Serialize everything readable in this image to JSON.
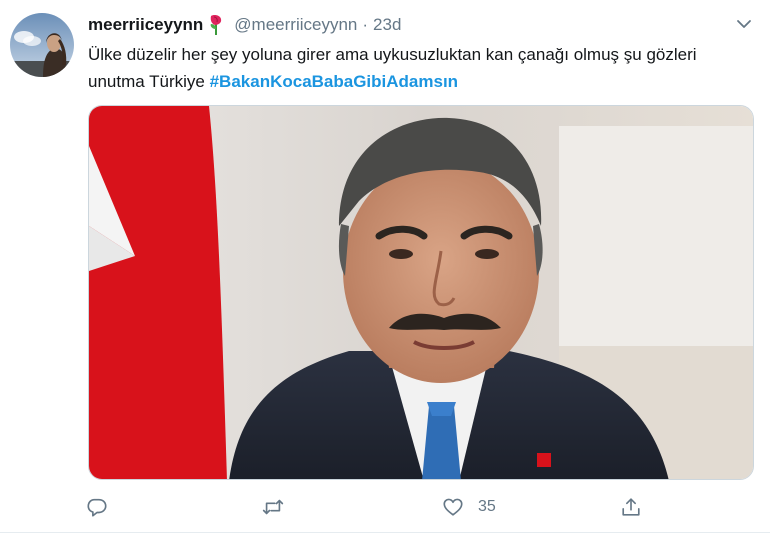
{
  "tweet": {
    "author": {
      "display_name": "meerriiceyynn",
      "name_emoji": "rose-emoji",
      "handle": "@meerriiceyynn",
      "separator": "·",
      "time": "23d"
    },
    "text_plain": "Ülke düzelir her şey yoluna girer ama uykusuzluktan kan çanağı olmuş şu gözleri unutma Türkiye",
    "hashtag": "#BakanKocaBabaGibiAdamsın",
    "media": {
      "type": "photo"
    },
    "actions": {
      "reply": {
        "icon": "reply-icon"
      },
      "retweet": {
        "icon": "retweet-icon"
      },
      "like": {
        "icon": "heart-icon",
        "count": "35"
      },
      "share": {
        "icon": "share-icon"
      }
    },
    "colors": {
      "hashtag": "#1b95e0",
      "secondary_text": "#657786",
      "flag_red": "#d8121b"
    }
  }
}
